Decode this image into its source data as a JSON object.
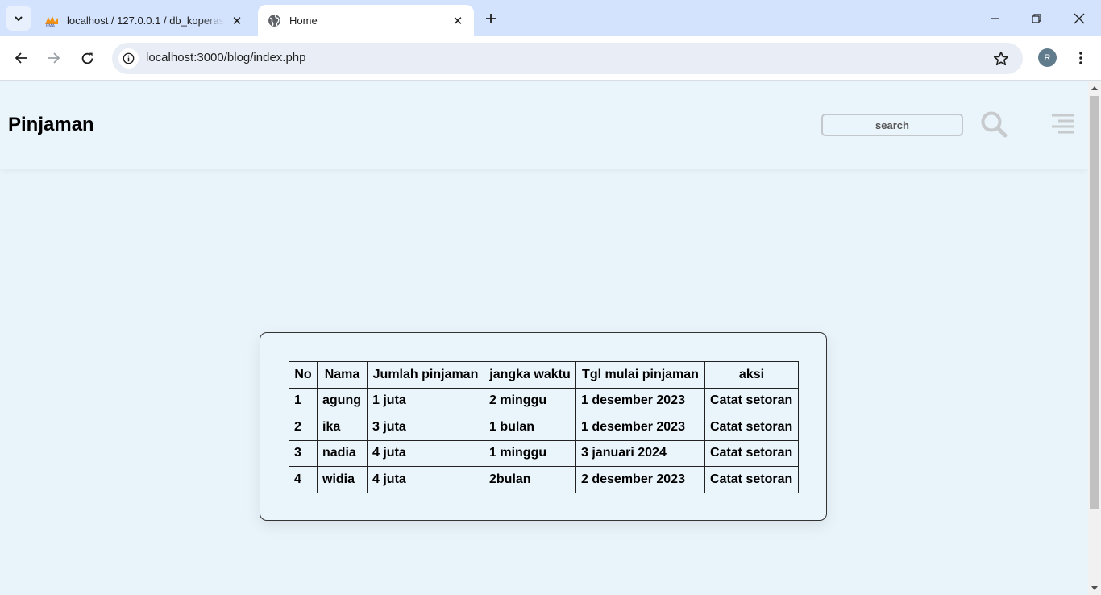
{
  "browser": {
    "tabs": [
      {
        "title": "localhost / 127.0.0.1 / db_koperasi",
        "favicon": "phpmyadmin-icon",
        "active": false
      },
      {
        "title": "Home",
        "favicon": "globe-icon",
        "active": true
      }
    ],
    "url": "localhost:3000/blog/index.php",
    "profile_initial": "R"
  },
  "page": {
    "title": "Pinjaman",
    "search_placeholder": "search"
  },
  "table": {
    "headers": [
      "No",
      "Nama",
      "Jumlah pinjaman",
      "jangka waktu",
      "Tgl mulai pinjaman",
      "aksi"
    ],
    "rows": [
      [
        "1",
        "agung",
        "1 juta",
        "2 minggu",
        "1 desember 2023",
        "Catat setoran"
      ],
      [
        "2",
        "ika",
        "3 juta",
        "1 bulan",
        "1 desember 2023",
        "Catat setoran"
      ],
      [
        "3",
        "nadia",
        "4 juta",
        "1 minggu",
        "3 januari 2024",
        "Catat setoran"
      ],
      [
        "4",
        "widia",
        "4 juta",
        "2bulan",
        "2 desember 2023",
        "Catat setoran"
      ]
    ]
  }
}
